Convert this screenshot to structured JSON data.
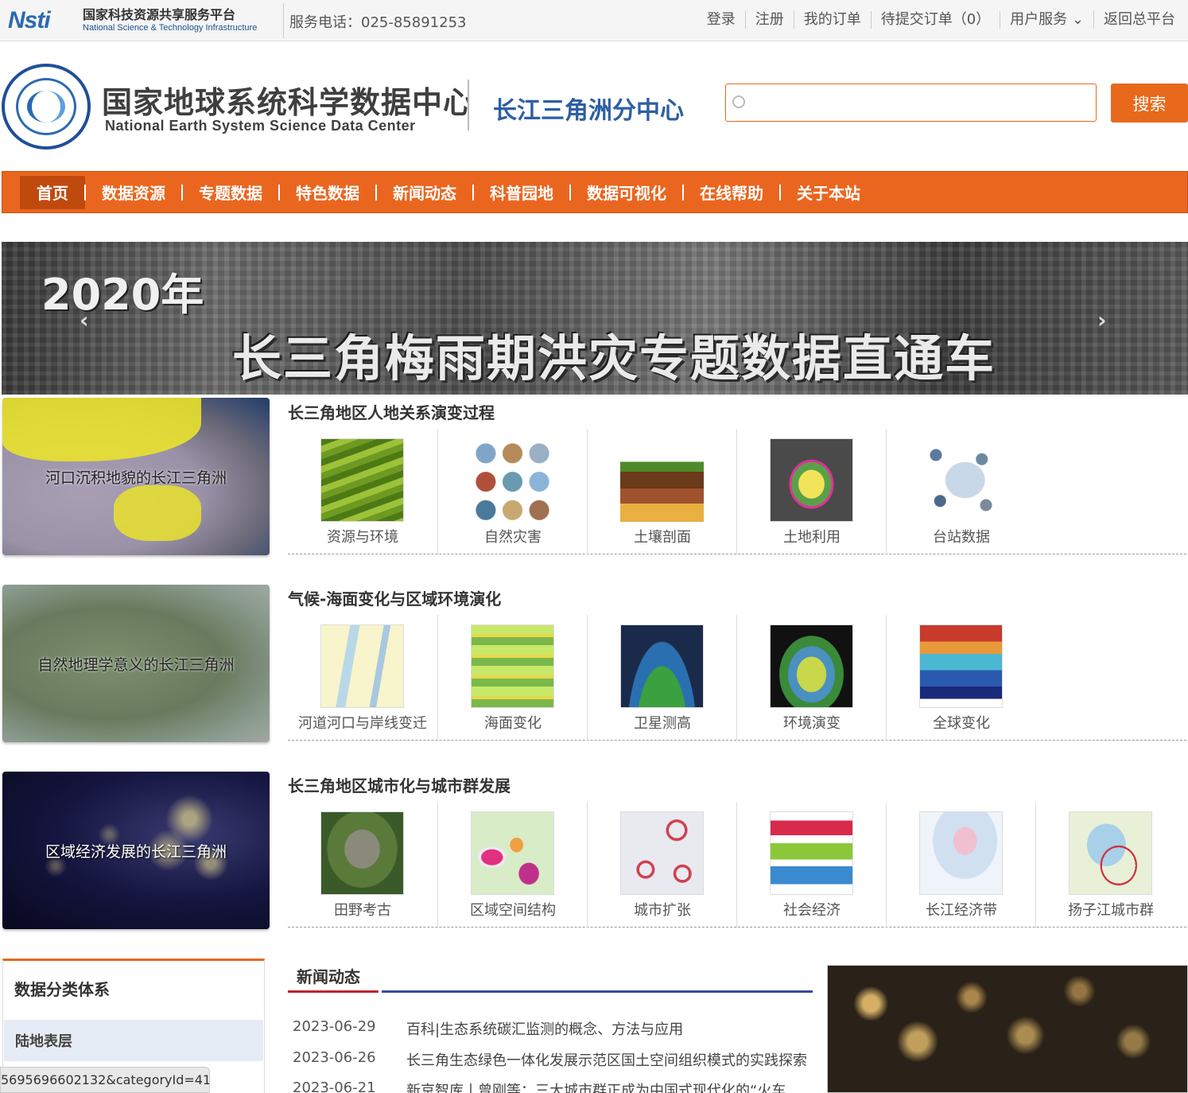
{
  "topbar": {
    "nsti_mark": "Nsti",
    "nsti_cn": "国家科技资源共享服务平台",
    "nsti_en": "National Science & Technology Infrastructure",
    "phone": "服务电话：025-85891253",
    "links": [
      "登录",
      "注册",
      "我的订单",
      "待提交订单（0）",
      "用户服务",
      "返回总平台"
    ]
  },
  "header": {
    "center_name": "国家地球系统科学数据中心",
    "center_en": "National Earth System Science Data Center",
    "sub_center": "长江三角洲分中心",
    "search_placeholder": "",
    "search_button": "搜索"
  },
  "nav": {
    "items": [
      "首页",
      "数据资源",
      "专题数据",
      "特色数据",
      "新闻动态",
      "科普园地",
      "数据可视化",
      "在线帮助",
      "关于本站"
    ],
    "active": "首页"
  },
  "banner": {
    "year": "2020年",
    "title": "长三角梅雨期洪灾专题数据直通车"
  },
  "sections": [
    {
      "side_caption": "河口沉积地貌的长江三角洲",
      "title": "长三角地区人地关系演变过程",
      "items": [
        "资源与环境",
        "自然灾害",
        "土壤剖面",
        "土地利用",
        "台站数据"
      ]
    },
    {
      "side_caption": "自然地理学意义的长江三角洲",
      "title": "气候-海面变化与区域环境演化",
      "items": [
        "河道河口与岸线变迁",
        "海面变化",
        "卫星测高",
        "环境演变",
        "全球变化"
      ]
    },
    {
      "side_caption": "区域经济发展的长江三角洲",
      "title": "长三角地区城市化与城市群发展",
      "items": [
        "田野考古",
        "区域空间结构",
        "城市扩张",
        "社会经济",
        "长江经济带",
        "扬子江城市群"
      ]
    }
  ],
  "category": {
    "title": "数据分类体系",
    "first_item": "陆地表层"
  },
  "news": {
    "title": "新闻动态",
    "rows": [
      {
        "date": "2023-06-29",
        "title": "百科|生态系统碳汇监测的概念、方法与应用"
      },
      {
        "date": "2023-06-26",
        "title": "长三角生态绿色一体化发展示范区国土空间组织模式的实践探索"
      },
      {
        "date": "2023-06-21",
        "title": "新京智库丨曾刚等：三大城市群正成为中国式现代化的“火车"
      }
    ]
  },
  "status_url": "5695696602132&categoryId=41"
}
